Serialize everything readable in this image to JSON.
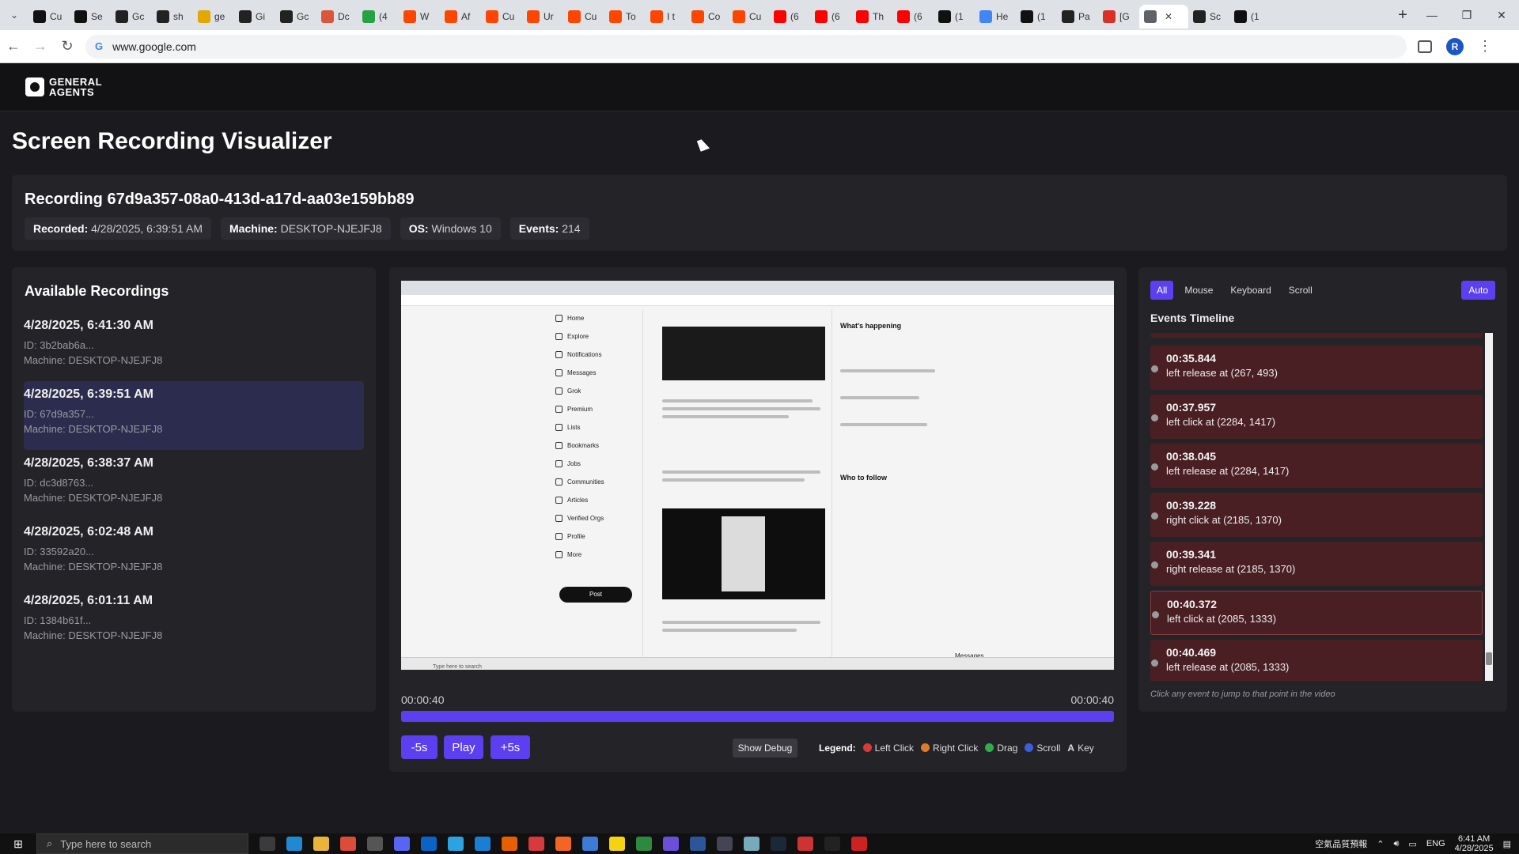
{
  "browser": {
    "tabs": [
      {
        "label": "Cu",
        "icon": "x-icon",
        "color": "#111111"
      },
      {
        "label": "Se",
        "icon": "x-icon",
        "color": "#111111"
      },
      {
        "label": "Gc",
        "icon": "grid-icon",
        "color": "#222222"
      },
      {
        "label": "sh",
        "icon": "github-icon",
        "color": "#222222"
      },
      {
        "label": "ge",
        "icon": "emoji-icon",
        "color": "#e0a800"
      },
      {
        "label": "Gi",
        "icon": "openai-icon",
        "color": "#222222"
      },
      {
        "label": "Gc",
        "icon": "grid-icon",
        "color": "#222222"
      },
      {
        "label": "Dc",
        "icon": "claude-icon",
        "color": "#d9573a"
      },
      {
        "label": "(4",
        "icon": "chat-icon",
        "color": "#25a244"
      },
      {
        "label": "W",
        "icon": "reddit-icon",
        "color": "#ff4500"
      },
      {
        "label": "Af",
        "icon": "reddit-icon",
        "color": "#ff4500"
      },
      {
        "label": "Cu",
        "icon": "reddit-icon",
        "color": "#ff4500"
      },
      {
        "label": "Ur",
        "icon": "reddit-icon",
        "color": "#ff4500"
      },
      {
        "label": "Cu",
        "icon": "reddit-icon",
        "color": "#ff4500"
      },
      {
        "label": "To",
        "icon": "reddit-icon",
        "color": "#ff4500"
      },
      {
        "label": "I t",
        "icon": "reddit-icon",
        "color": "#ff4500"
      },
      {
        "label": "Co",
        "icon": "reddit-icon",
        "color": "#ff4500"
      },
      {
        "label": "Cu",
        "icon": "reddit-icon",
        "color": "#ff4500"
      },
      {
        "label": "(6",
        "icon": "youtube-icon",
        "color": "#ff0000"
      },
      {
        "label": "(6",
        "icon": "youtube-icon",
        "color": "#ff0000"
      },
      {
        "label": "Th",
        "icon": "youtube-icon",
        "color": "#ff0000"
      },
      {
        "label": "(6",
        "icon": "youtube-icon",
        "color": "#ff0000"
      },
      {
        "label": "(1",
        "icon": "x-icon",
        "color": "#111111"
      },
      {
        "label": "He",
        "icon": "google-icon",
        "color": "#4285f4"
      },
      {
        "label": "(1",
        "icon": "x-icon",
        "color": "#111111"
      },
      {
        "label": "Pa",
        "icon": "github-icon",
        "color": "#222222"
      },
      {
        "label": "[G",
        "icon": "gmail-icon",
        "color": "#d93025"
      },
      {
        "label": "",
        "icon": "globe-icon",
        "color": "#5f6368",
        "active": true
      },
      {
        "label": "Sc",
        "icon": "github-icon",
        "color": "#222222"
      },
      {
        "label": "(1",
        "icon": "x-icon",
        "color": "#111111"
      }
    ],
    "url": "www.google.com",
    "profile_initial": "R"
  },
  "app": {
    "logo_line1": "GENERAL",
    "logo_line2": "AGENTS",
    "page_title": "Screen Recording Visualizer",
    "recording": {
      "title": "Recording 67d9a357-08a0-413d-a17d-aa03e159bb89",
      "recorded_label": "Recorded:",
      "recorded_value": "4/28/2025, 6:39:51 AM",
      "machine_label": "Machine:",
      "machine_value": "DESKTOP-NJEJFJ8",
      "os_label": "OS:",
      "os_value": "Windows 10",
      "events_label": "Events:",
      "events_value": "214"
    },
    "available": {
      "heading": "Available Recordings",
      "items": [
        {
          "date": "4/28/2025, 6:41:30 AM",
          "id": "ID: 3b2bab6a...",
          "machine": "Machine: DESKTOP-NJEJFJ8"
        },
        {
          "date": "4/28/2025, 6:39:51 AM",
          "id": "ID: 67d9a357...",
          "machine": "Machine: DESKTOP-NJEJFJ8",
          "selected": true
        },
        {
          "date": "4/28/2025, 6:38:37 AM",
          "id": "ID: dc3d8763...",
          "machine": "Machine: DESKTOP-NJEJFJ8"
        },
        {
          "date": "4/28/2025, 6:02:48 AM",
          "id": "ID: 33592a20...",
          "machine": "Machine: DESKTOP-NJEJFJ8"
        },
        {
          "date": "4/28/2025, 6:01:11 AM",
          "id": "ID: 1384b61f...",
          "machine": "Machine: DESKTOP-NJEJFJ8"
        }
      ]
    },
    "player": {
      "time_current": "00:00:40",
      "time_total": "00:00:40",
      "progress": 1.0,
      "back_label": "-5s",
      "play_label": "Play",
      "fwd_label": "+5s",
      "debug_label": "Show Debug",
      "legend_label": "Legend:",
      "legend": [
        {
          "label": "Left Click",
          "color": "#d83a3a"
        },
        {
          "label": "Right Click",
          "color": "#e07a2a"
        },
        {
          "label": "Drag",
          "color": "#2fae4a"
        },
        {
          "label": "Scroll",
          "color": "#3a5fd8"
        },
        {
          "label": "Key",
          "symbol": "A"
        }
      ],
      "video": {
        "x_nav": [
          "Home",
          "Explore",
          "Notifications",
          "Messages",
          "Grok",
          "Premium",
          "Lists",
          "Bookmarks",
          "Jobs",
          "Communities",
          "Articles",
          "Verified Orgs",
          "Profile",
          "More"
        ],
        "post_label": "Post",
        "whats_happening": "What's happening",
        "who_to_follow": "Who to follow",
        "messages": "Messages",
        "search_placeholder": "Type here to search"
      }
    },
    "timeline": {
      "filters": [
        {
          "label": "All",
          "active": true
        },
        {
          "label": "Mouse"
        },
        {
          "label": "Keyboard"
        },
        {
          "label": "Scroll"
        }
      ],
      "auto_label": "Auto",
      "title": "Events Timeline",
      "events": [
        {
          "time": "00:35.844",
          "desc": "left release at (267, 493)"
        },
        {
          "time": "00:37.957",
          "desc": "left click at (2284, 1417)"
        },
        {
          "time": "00:38.045",
          "desc": "left release at (2284, 1417)"
        },
        {
          "time": "00:39.228",
          "desc": "right click at (2185, 1370)"
        },
        {
          "time": "00:39.341",
          "desc": "right release at (2185, 1370)"
        },
        {
          "time": "00:40.372",
          "desc": "left click at (2085, 1333)",
          "current": true
        },
        {
          "time": "00:40.469",
          "desc": "left release at (2085, 1333)"
        }
      ],
      "hint": "Click any event to jump to that point in the video"
    }
  },
  "taskbar": {
    "search_placeholder": "Type here to search",
    "weather": "空氣品質預報",
    "lang": "ENG",
    "time": "6:41 AM",
    "date": "4/28/2025"
  }
}
